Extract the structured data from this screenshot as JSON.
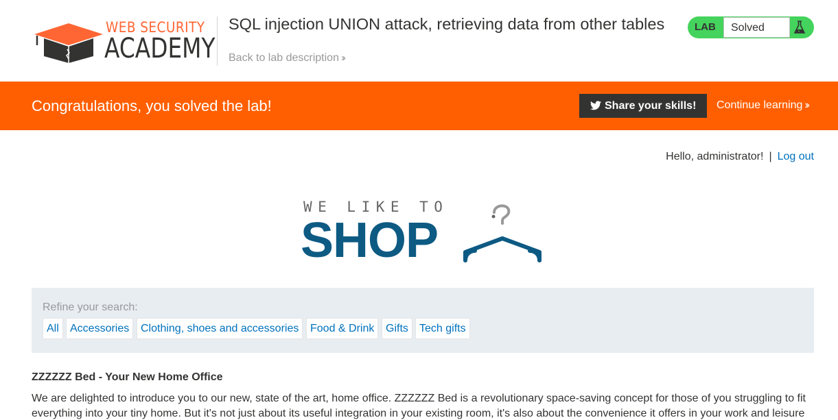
{
  "header": {
    "logo_top": "WEB SECURITY",
    "logo_bottom": "ACADEMY",
    "lab_title": "SQL injection UNION attack, retrieving data from other tables",
    "back_link": "Back to lab description",
    "lab_badge": {
      "label": "LAB",
      "status": "Solved"
    }
  },
  "banner": {
    "message": "Congratulations, you solved the lab!",
    "share_label": "Share your skills!",
    "continue_label": "Continue learning"
  },
  "account": {
    "greeting": "Hello, administrator!",
    "separator": "|",
    "logout": "Log out"
  },
  "shop_logo": {
    "tagline": "WE LIKE TO",
    "word": "SHOP"
  },
  "filter": {
    "label": "Refine your search:",
    "categories": [
      "All",
      "Accessories",
      "Clothing, shoes and accessories",
      "Food & Drink",
      "Gifts",
      "Tech gifts"
    ]
  },
  "article": {
    "title": "ZZZZZZ Bed - Your New Home Office",
    "body": "We are delighted to introduce you to our new, state of the art, home office. ZZZZZZ Bed is a revolutionary space-saving concept for those of you struggling to fit everything into your tiny home. But it's not just about its useful integration in your existing room, it's also about the convenience it offers in your work and leisure"
  },
  "colors": {
    "accent_orange": "#ff6633",
    "banner_orange": "#ff5f00",
    "badge_green": "#44d35c",
    "link_blue": "#0071bc",
    "shop_blue": "#0d5a83",
    "filter_bg": "#e8edf2"
  },
  "icons": [
    "academy-logo-icon",
    "chevron-double-right-icon",
    "flask-icon",
    "twitter-icon",
    "coat-hanger-icon"
  ]
}
